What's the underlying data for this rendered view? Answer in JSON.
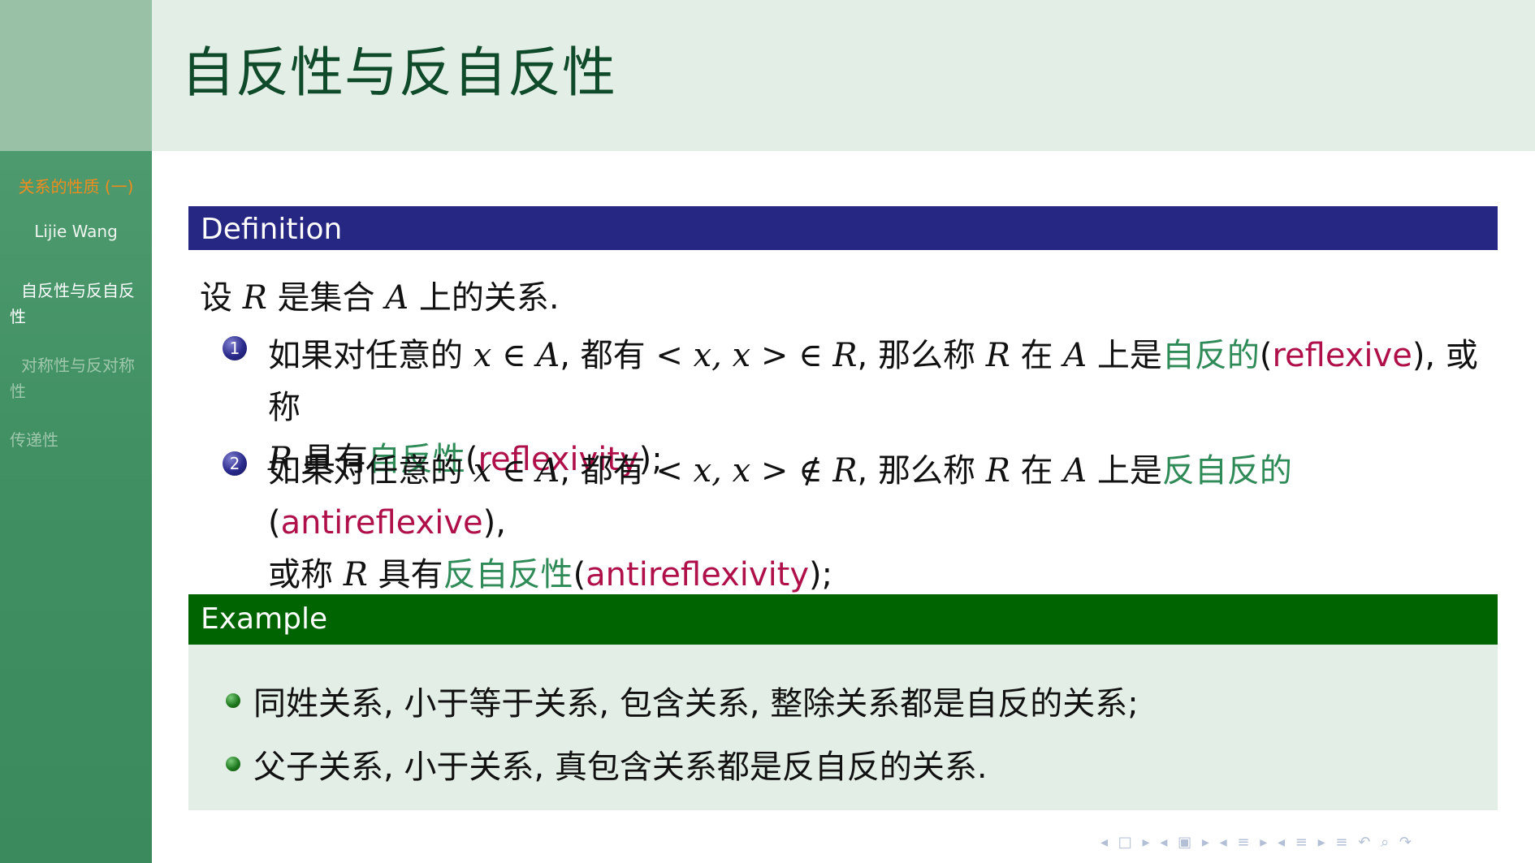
{
  "sidebar": {
    "short_title": "关系的性质 (一)",
    "author": "Lijie Wang",
    "items": [
      {
        "label": "自反性与反自反性",
        "active": true
      },
      {
        "label": "对称性与反对称性",
        "active": false
      },
      {
        "label": "传递性",
        "active": false
      }
    ]
  },
  "header": {
    "title": "自反性与反自反性"
  },
  "definition": {
    "heading": "Definition",
    "intro_pre": "设 ",
    "intro_R": "R",
    "intro_mid": " 是集合 ",
    "intro_A": "A",
    "intro_post": " 上的关系.",
    "items": [
      {
        "number": "1",
        "pre": "如果对任意的 ",
        "math1": "x ∈ A",
        "mid1": ", 都有 ",
        "math2": "< x, x > ∈ R",
        "mid2": ", 那么称 ",
        "math3": "R",
        "mid3": " 在 ",
        "math4": "A",
        "mid4": " 上是",
        "term1": "自反的",
        "en1": "reflexive",
        "mid5": "), 或称",
        "math5": "R",
        "mid6": " 具有",
        "term2": "自反性",
        "en2": "reflexivity",
        "end": ");"
      },
      {
        "number": "2",
        "pre": "如果对任意的 ",
        "math1": "x ∈ A",
        "mid1": ", 都有 ",
        "math2": "< x, x > ∉ R",
        "mid2": ", 那么称 ",
        "math3": "R",
        "mid3": " 在 ",
        "math4": "A",
        "mid4": " 上是",
        "term1": "反自反的",
        "en1": "antireflexive",
        "mid5": "),",
        "pre2": "或称 ",
        "math5": "R",
        "mid6": " 具有",
        "term2": "反自反性",
        "en2": "antireflexivity",
        "end": ");"
      }
    ]
  },
  "example": {
    "heading": "Example",
    "items": [
      "同姓关系, 小于等于关系, 包含关系, 整除关系都是自反的关系;",
      "父子关系, 小于关系, 真包含关系都是反自反的关系."
    ]
  },
  "navbar": {
    "icons": [
      "nav-prev-frame-icon",
      "nav-frame-icon",
      "nav-next-frame-icon",
      "nav-prev-subsection-icon",
      "nav-subsection-icon",
      "nav-next-subsection-icon",
      "nav-prev-section-icon",
      "nav-section-icon",
      "nav-next-section-icon",
      "nav-prev-doc-icon",
      "nav-doc-icon",
      "nav-next-doc-icon",
      "nav-appendix-icon",
      "nav-back-icon",
      "nav-search-icon",
      "nav-forward-icon"
    ],
    "glyphs": [
      "◂",
      "□",
      "▸",
      "◂",
      "▣",
      "▸",
      "◂",
      "≡",
      "▸",
      "◂",
      "≡",
      "▸",
      "≡",
      "↶",
      "⌕",
      "↷"
    ]
  },
  "colors": {
    "sidebar": "#3f8f63",
    "header_bg": "#e3eee6",
    "title": "#0f4a2a",
    "definition_head": "#262683",
    "example_head": "#006400",
    "example_body": "#e3eee6",
    "term_green": "#2e8b57",
    "term_red": "#b0104a",
    "short_title": "#f08c1e"
  }
}
